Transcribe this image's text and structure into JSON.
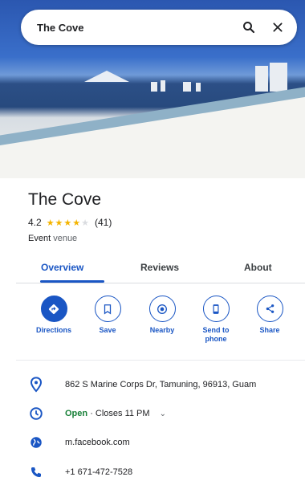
{
  "search": {
    "query": "The Cove",
    "search_icon": "search-icon",
    "close_icon": "close-icon"
  },
  "hero_image": {
    "subject": "beach-photo"
  },
  "place": {
    "name": "The Cove",
    "rating": "4.2",
    "stars_filled": 4,
    "stars_total": 5,
    "review_count": "(41)",
    "category_primary": "Event",
    "category_secondary": "venue"
  },
  "tabs": [
    {
      "label": "Overview",
      "active": true
    },
    {
      "label": "Reviews",
      "active": false
    },
    {
      "label": "About",
      "active": false
    }
  ],
  "actions": [
    {
      "label": "Directions",
      "icon": "directions-icon"
    },
    {
      "label": "Save",
      "icon": "bookmark-icon"
    },
    {
      "label": "Nearby",
      "icon": "nearby-icon"
    },
    {
      "label": "Send to phone",
      "icon": "phone-icon"
    },
    {
      "label": "Share",
      "icon": "share-icon"
    }
  ],
  "info": {
    "address": "862 S Marine Corps Dr, Tamuning, 96913, Guam",
    "hours_status": "Open",
    "hours_detail": "· Closes 11 PM",
    "website": "m.facebook.com",
    "phone": "+1 671-472-7528"
  },
  "colors": {
    "accent": "#1a56c4",
    "star": "#f4b400",
    "open": "#188038"
  }
}
